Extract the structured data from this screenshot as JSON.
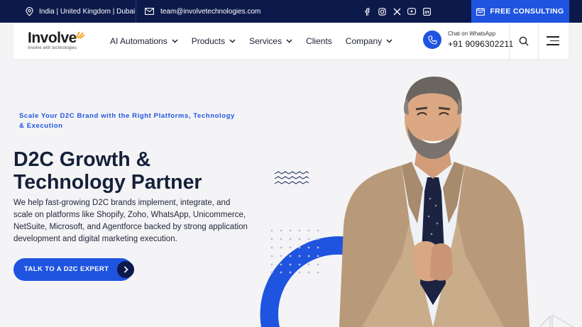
{
  "topbar": {
    "location": "India | United Kingdom | Dubai",
    "email": "team@involvetechnologies.com",
    "social_icons": [
      "facebook-icon",
      "instagram-icon",
      "x-twitter-icon",
      "youtube-icon",
      "linkedin-icon"
    ],
    "cta_label": "FREE CONSULTING"
  },
  "brand": {
    "name": "Involve",
    "tagline": "Involve with technologies"
  },
  "nav": {
    "items": [
      {
        "label": "AI Automations",
        "dropdown": true
      },
      {
        "label": "Products",
        "dropdown": true
      },
      {
        "label": "Services",
        "dropdown": true
      },
      {
        "label": "Clients",
        "dropdown": false
      },
      {
        "label": "Company",
        "dropdown": true
      }
    ]
  },
  "whatsapp": {
    "label": "Chat on WhatsApp",
    "number": "+91 9096302211"
  },
  "hero": {
    "eyebrow": "Scale Your D2C Brand with the Right Platforms, Technology & Execution",
    "title": "D2C Growth & Technology Partner",
    "description": "We help fast-growing D2C brands implement, integrate, and scale on platforms like Shopify, Zoho, WhatsApp, Unicommerce, NetSuite, Microsoft, and Agentforce backed by strong application development and digital marketing execution.",
    "cta_label": "TALK TO A D2C EXPERT"
  },
  "colors": {
    "navy": "#0c1a4b",
    "accent_blue": "#1f54e0",
    "logo_orange": "#f4a21b",
    "page_bg": "#f4f4f6"
  }
}
